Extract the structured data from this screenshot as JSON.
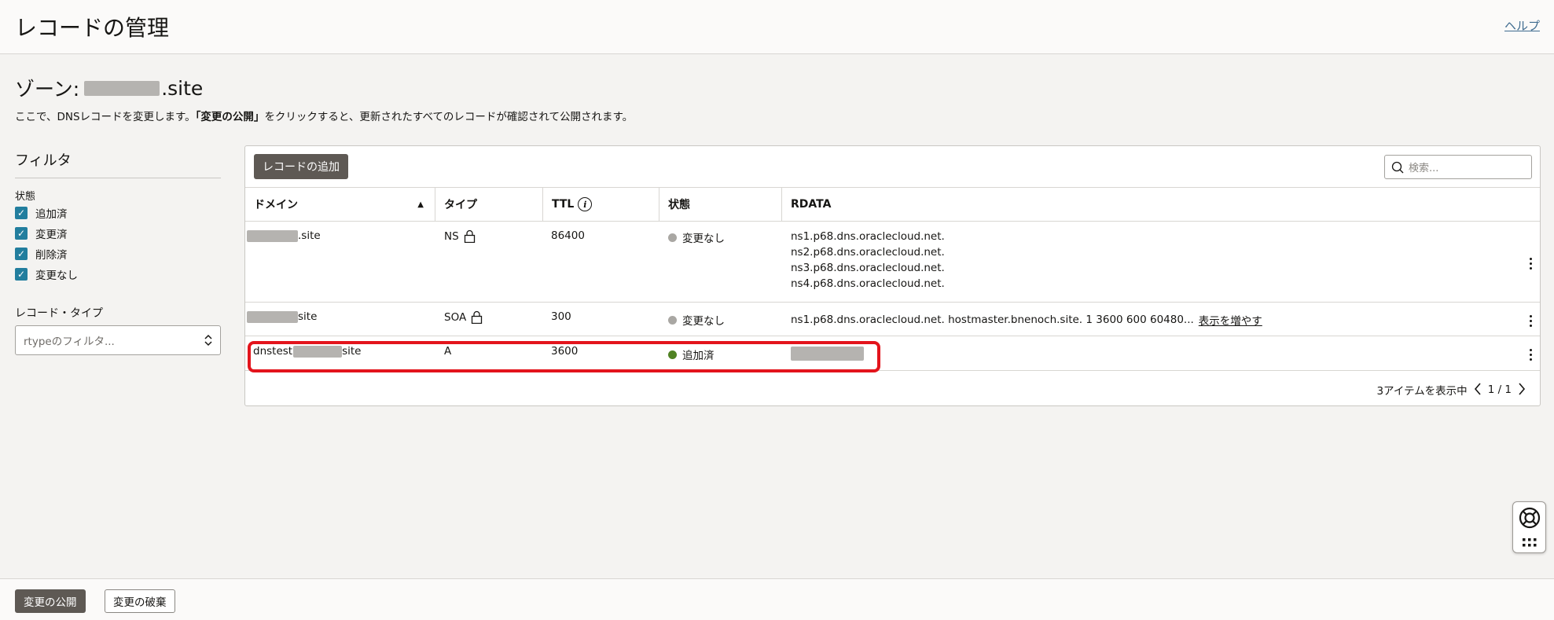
{
  "header": {
    "title": "レコードの管理",
    "help_label": "ヘルプ"
  },
  "zone": {
    "title_prefix": "ゾーン:",
    "title_suffix": ".site",
    "description_before": "ここで、DNSレコードを変更します。",
    "description_bold": "「変更の公開」",
    "description_after": "をクリックすると、更新されたすべてのレコードが確認されて公開されます。"
  },
  "filters": {
    "heading": "フィルタ",
    "state_label": "状態",
    "states": [
      "追加済",
      "変更済",
      "削除済",
      "変更なし"
    ],
    "record_type_label": "レコード・タイプ",
    "record_type_placeholder": "rtypeのフィルタ..."
  },
  "table": {
    "add_button": "レコードの追加",
    "search_placeholder": "検索...",
    "columns": {
      "domain": "ドメイン",
      "type": "タイプ",
      "ttl": "TTL",
      "state": "状態",
      "rdata": "RDATA"
    },
    "rows": [
      {
        "domain_prefix": "",
        "domain_suffix": ".site",
        "type": "NS",
        "locked": true,
        "ttl": "86400",
        "state": "変更なし",
        "state_color": "#a9a7a3",
        "rdata": [
          "ns1.p68.dns.oraclecloud.net.",
          "ns2.p68.dns.oraclecloud.net.",
          "ns3.p68.dns.oraclecloud.net.",
          "ns4.p68.dns.oraclecloud.net."
        ]
      },
      {
        "domain_prefix": "",
        "domain_suffix": "site",
        "type": "SOA",
        "locked": true,
        "ttl": "300",
        "state": "変更なし",
        "state_color": "#a9a7a3",
        "rdata": [
          "ns1.p68.dns.oraclecloud.net. hostmaster.bnenoch.site. 1 3600 600 60480..."
        ],
        "rdata_more": "表示を増やす"
      },
      {
        "domain_prefix": "dnstest",
        "domain_suffix": "site",
        "type": "A",
        "locked": false,
        "ttl": "3600",
        "state": "追加済",
        "state_color": "#508223",
        "rdata": []
      }
    ],
    "pager_count": "3アイテムを表示中",
    "pager_pages": "1 / 1"
  },
  "footer": {
    "publish_button": "変更の公開",
    "discard_button": "変更の破棄"
  },
  "colors": {
    "accent_checkbox": "#227e9e",
    "primary_button": "#5e5954",
    "highlight": "#e3141c"
  }
}
